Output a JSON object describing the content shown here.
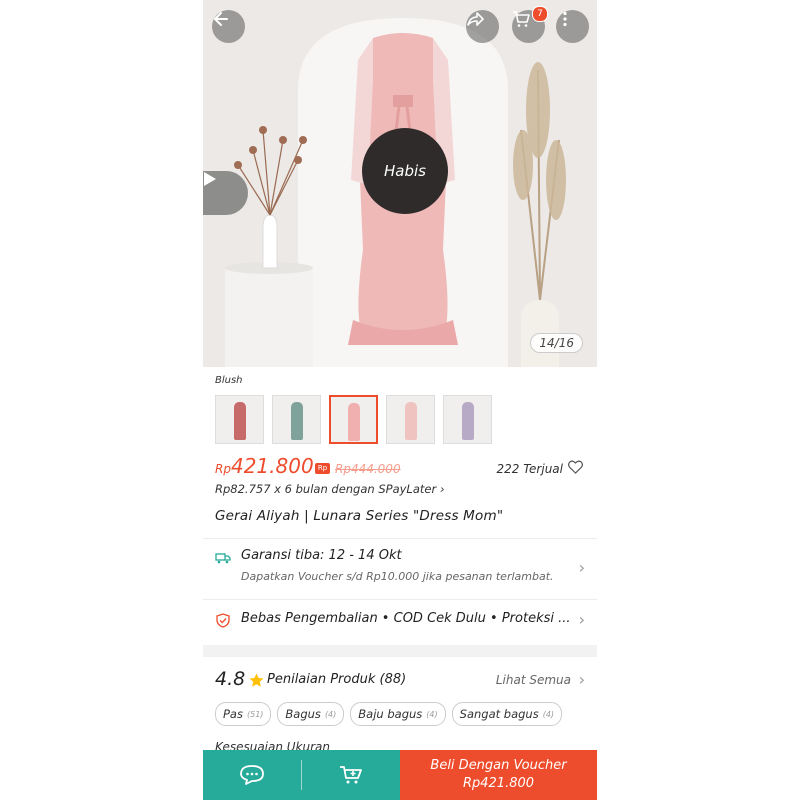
{
  "header": {
    "cart_count": "7",
    "icons": [
      "back-arrow-icon",
      "share-icon",
      "cart-icon",
      "more-vertical-icon"
    ]
  },
  "media": {
    "soldout_label": "Habis",
    "counter": "14/16"
  },
  "variants": {
    "label": "Blush",
    "items": [
      {
        "color": "#c76a6a",
        "selected": false
      },
      {
        "color": "#7fa39a",
        "selected": false
      },
      {
        "color": "#f0b0b0",
        "selected": true
      },
      {
        "color": "#efc4c0",
        "selected": false
      },
      {
        "color": "#b7aac7",
        "selected": false
      }
    ]
  },
  "price": {
    "currency": "Rp",
    "value": "421.800",
    "original": "Rp444.000",
    "sold": "222 Terjual",
    "spaylater": "Rp82.757 x 6 bulan dengan SPayLater ›"
  },
  "product": {
    "title": "Gerai Aliyah | Lunara Series \"Dress Mom\""
  },
  "shipping": {
    "title": "Garansi tiba: 12 - 14 Okt",
    "subtitle": "Dapatkan Voucher s/d Rp10.000 jika pesanan terlambat."
  },
  "protection": {
    "text": "Bebas Pengembalian • COD Cek Dulu • Proteksi ..."
  },
  "rating": {
    "score": "4.8",
    "label": "Penilaian Produk (88)",
    "see_all": "Lihat Semua",
    "chips": [
      {
        "label": "Pas",
        "count": "(51)"
      },
      {
        "label": "Bagus",
        "count": "(4)"
      },
      {
        "label": "Baju bagus",
        "count": "(4)"
      },
      {
        "label": "Sangat bagus",
        "count": "(4)"
      }
    ],
    "next_section": "Kesesuaian Ukuran"
  },
  "bottom_bar": {
    "buy_line1": "Beli Dengan Voucher",
    "buy_line2": "Rp421.800"
  },
  "colors": {
    "accent": "#ee4d2d",
    "teal": "#26aa99"
  }
}
